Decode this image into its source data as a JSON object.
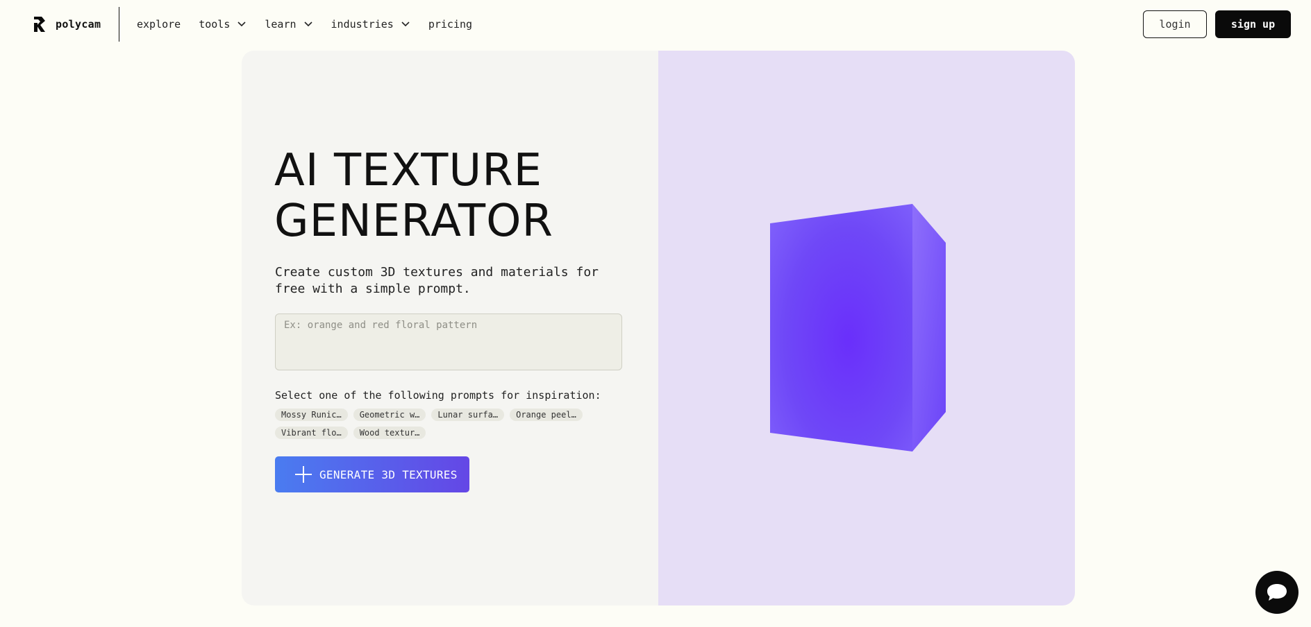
{
  "brand": {
    "name": "polycam"
  },
  "nav": {
    "links": [
      {
        "label": "explore",
        "has_dropdown": false
      },
      {
        "label": "tools",
        "has_dropdown": true
      },
      {
        "label": "learn",
        "has_dropdown": true
      },
      {
        "label": "industries",
        "has_dropdown": true
      },
      {
        "label": "pricing",
        "has_dropdown": false
      }
    ],
    "login_label": "login",
    "signup_label": "sign up"
  },
  "hero": {
    "title_line1": "AI TEXTURE",
    "title_line2": "GENERATOR",
    "subtitle": "Create custom 3D textures and materials for free with a simple prompt.",
    "prompt_placeholder": "Ex: orange and red floral pattern",
    "prompt_value": "",
    "inspiration_label": "Select one of the following prompts for inspiration:",
    "chips": [
      "Mossy Runic…",
      "Geometric w…",
      "Lunar surfa…",
      "Orange peel…",
      "Vibrant flo…",
      "Wood textur…"
    ],
    "generate_label": "GENERATE 3D TEXTURES"
  },
  "colors": {
    "page_bg": "#fdfdf6",
    "left_panel": "#f5f5f2",
    "right_panel": "#e6def6",
    "cube_purple": "#6a3df5",
    "button_gradient_start": "#4a7cf0",
    "button_gradient_end": "#6447e6"
  },
  "icons": [
    "polycam-logo-icon",
    "chevron-down-icon",
    "plus-icon",
    "chat-icon"
  ]
}
